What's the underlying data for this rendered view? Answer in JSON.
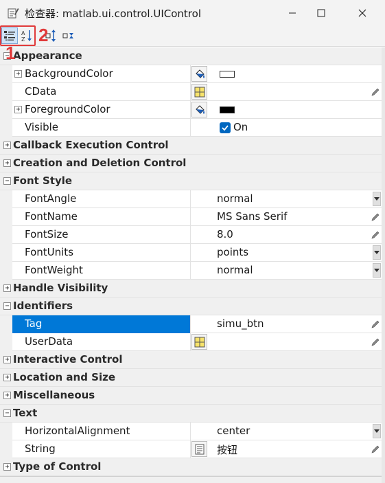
{
  "window": {
    "title": "检查器:  matlab.ui.control.UIControl",
    "minimize_icon": "minimize-icon",
    "maximize_icon": "maximize-icon",
    "close_icon": "close-icon"
  },
  "toolbar": {
    "buttons": [
      {
        "name": "categorized-view",
        "icon": "categorized-icon",
        "active": true
      },
      {
        "name": "alphabetical-view",
        "icon": "sort-az-icon",
        "active": false
      },
      {
        "name": "expand-all",
        "icon": "expand-all-icon",
        "active": false
      },
      {
        "name": "collapse-all",
        "icon": "collapse-all-icon",
        "active": false
      }
    ],
    "callouts": [
      "1",
      "2"
    ],
    "callout_color": "#e03a3a"
  },
  "categories": {
    "appearance": {
      "label": "Appearance",
      "expanded": true,
      "props": {
        "background_color": {
          "name": "BackgroundColor"
        },
        "cdata": {
          "name": "CData"
        },
        "foreground_color": {
          "name": "ForegroundColor"
        },
        "visible": {
          "name": "Visible",
          "value": "On",
          "checked": true
        }
      }
    },
    "callback": {
      "label": "Callback Execution Control",
      "expanded": false
    },
    "creation": {
      "label": "Creation and Deletion Control",
      "expanded": false
    },
    "font_style": {
      "label": "Font Style",
      "expanded": true,
      "props": {
        "font_angle": {
          "name": "FontAngle",
          "value": "normal"
        },
        "font_name": {
          "name": "FontName",
          "value": "MS Sans Serif"
        },
        "font_size": {
          "name": "FontSize",
          "value": "8.0"
        },
        "font_units": {
          "name": "FontUnits",
          "value": "points"
        },
        "font_weight": {
          "name": "FontWeight",
          "value": "normal"
        }
      }
    },
    "handle_visibility": {
      "label": "Handle Visibility",
      "expanded": false
    },
    "identifiers": {
      "label": "Identifiers",
      "expanded": true,
      "props": {
        "tag": {
          "name": "Tag",
          "value": "simu_btn",
          "selected": true
        },
        "user_data": {
          "name": "UserData"
        }
      }
    },
    "interactive": {
      "label": "Interactive Control",
      "expanded": false
    },
    "location": {
      "label": "Location and Size",
      "expanded": false
    },
    "misc": {
      "label": "Miscellaneous",
      "expanded": false
    },
    "text": {
      "label": "Text",
      "expanded": true,
      "props": {
        "horizontal_alignment": {
          "name": "HorizontalAlignment",
          "value": "center"
        },
        "string": {
          "name": "String",
          "value": "按钮"
        }
      }
    },
    "type_of_control": {
      "label": "Type of Control",
      "expanded": false
    }
  },
  "glyphs": {
    "collapse": "−",
    "expand": "+"
  },
  "colors": {
    "selection": "#0078d7",
    "category_bg": "#f0f0f0",
    "checkbox": "#0067c0",
    "background_swatch": "#ffffff",
    "foreground_swatch": "#000000"
  }
}
